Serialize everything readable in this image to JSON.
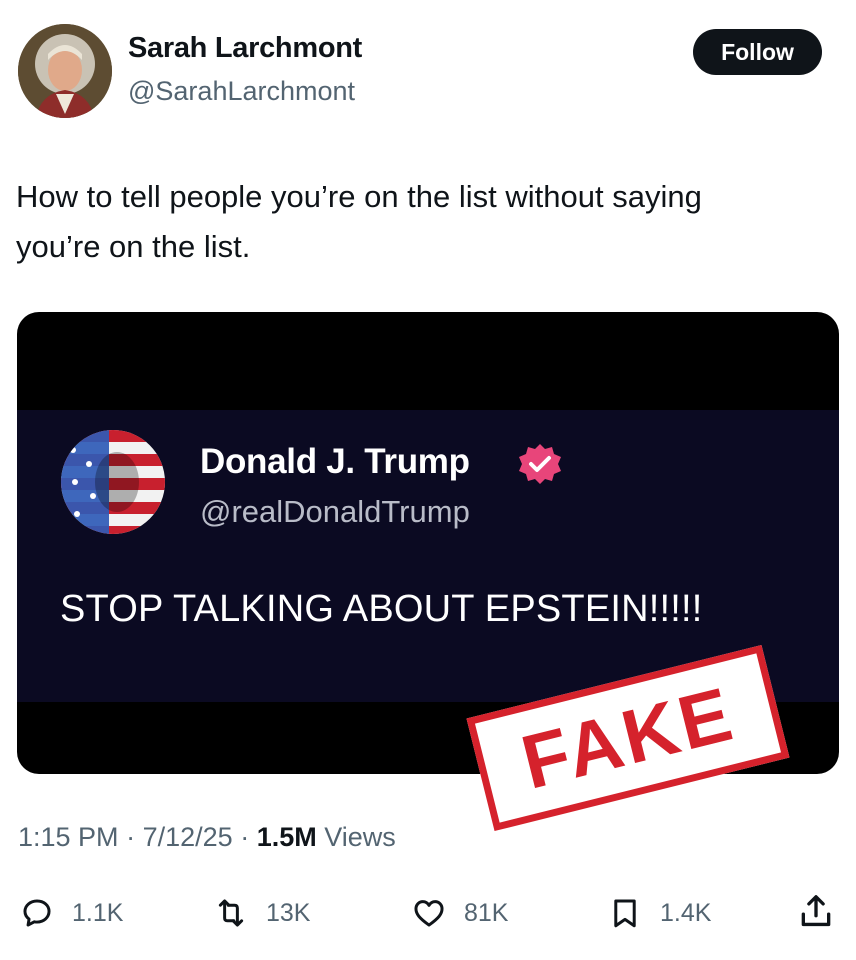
{
  "author": {
    "display_name": "Sarah Larchmont",
    "handle": "@SarahLarchmont",
    "avatar_icon": "profile-avatar"
  },
  "follow_button": {
    "label": "Follow"
  },
  "tweet": {
    "text_line1": "How to tell people you’re on the list without saying",
    "text_line2": "you’re on the list."
  },
  "media": {
    "embedded_post": {
      "display_name": "Donald J. Trump",
      "handle": "@realDonaldTrump",
      "verified_icon": "verified-badge-icon",
      "text": "STOP TALKING ABOUT EPSTEIN!!!!!"
    },
    "stamp": {
      "text": "FAKE",
      "color": "#d5222c"
    }
  },
  "meta": {
    "time": "1:15 PM",
    "date": "7/12/25",
    "views_count": "1.5M",
    "views_label": "Views"
  },
  "actions": {
    "replies": "1.1K",
    "reposts": "13K",
    "likes": "81K",
    "bookmarks": "1.4K"
  },
  "colors": {
    "text_primary": "#0f1419",
    "text_secondary": "#536471",
    "embedded_bg": "#0b0a22",
    "verified": "#e8457a"
  }
}
